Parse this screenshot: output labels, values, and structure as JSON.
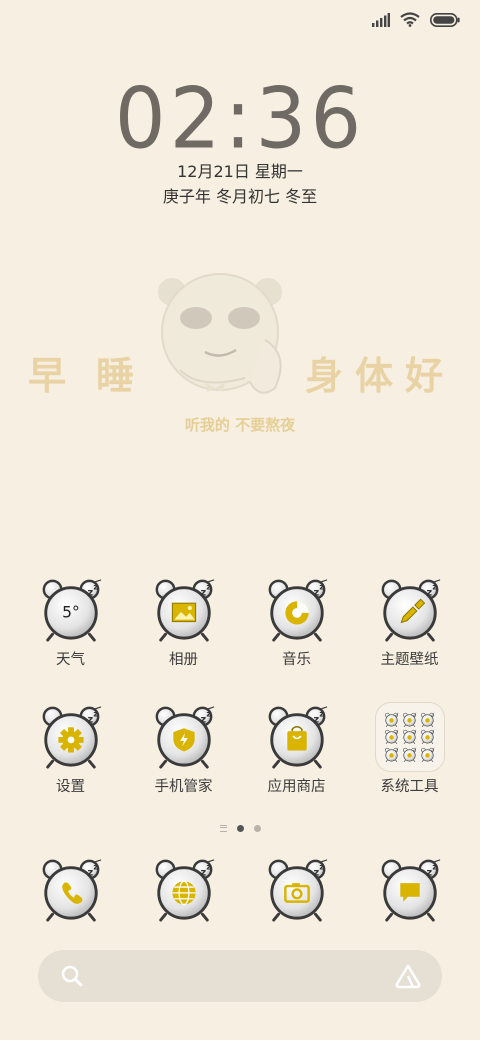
{
  "status": {
    "signal": "signal-icon",
    "wifi": "wifi-icon",
    "battery": "battery-icon"
  },
  "lockscreen": {
    "time": "02:36",
    "date": "12月21日 星期一",
    "lunar": "庚子年 冬月初七 冬至"
  },
  "banner": {
    "left_text": "早睡",
    "right_text": "身体好",
    "subtitle": "听我的 不要熬夜"
  },
  "apps_row1": [
    {
      "label": "天气",
      "icon": "weather-icon",
      "badge": "5°"
    },
    {
      "label": "相册",
      "icon": "gallery-icon"
    },
    {
      "label": "音乐",
      "icon": "music-icon"
    },
    {
      "label": "主题壁纸",
      "icon": "theme-brush-icon"
    }
  ],
  "apps_row2": [
    {
      "label": "设置",
      "icon": "gear-icon"
    },
    {
      "label": "手机管家",
      "icon": "security-shield-icon"
    },
    {
      "label": "应用商店",
      "icon": "app-store-icon"
    },
    {
      "label": "系统工具",
      "icon": "folder-icon"
    }
  ],
  "dock": [
    {
      "icon": "phone-icon"
    },
    {
      "icon": "browser-globe-icon"
    },
    {
      "icon": "camera-icon"
    },
    {
      "icon": "message-icon"
    }
  ],
  "colors": {
    "background": "#f6efe2",
    "accent_yellow": "#d9b400",
    "clock": "#6f6a64",
    "banner_text": "#e9d3a4"
  },
  "search": {
    "left_icon": "search-icon",
    "right_icon": "assistant-icon"
  }
}
